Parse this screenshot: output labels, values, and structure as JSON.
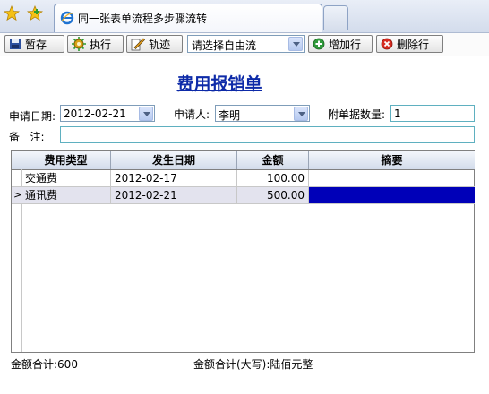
{
  "browser": {
    "tab_title": "同一张表单流程多步骤流转"
  },
  "toolbar": {
    "save_label": "暂存",
    "execute_label": "执行",
    "trace_label": "轨迹",
    "flow_select_value": "请选择自由流",
    "add_row_label": "增加行",
    "delete_row_label": "删除行"
  },
  "form": {
    "title": "费用报销单",
    "apply_date_label": "申请日期:",
    "apply_date_value": "2012-02-21",
    "applicant_label": "申请人:",
    "applicant_value": "李明",
    "attachment_count_label": "附单据数量:",
    "attachment_count_value": "1",
    "remark_label": "备   注:",
    "remark_value": ""
  },
  "grid": {
    "columns": [
      "费用类型",
      "发生日期",
      "金额",
      "摘要"
    ],
    "rows": [
      {
        "type": "交通费",
        "date": "2012-02-17",
        "amount": "100.00",
        "summary": ""
      },
      {
        "type": "通讯费",
        "date": "2012-02-21",
        "amount": "500.00",
        "summary": ""
      }
    ],
    "current_row_indicator": ">"
  },
  "footer": {
    "total_label": "金额合计:",
    "total_value": "600",
    "total_upper_label": "金额合计(大写):",
    "total_upper_value": "陆佰元整"
  },
  "colors": {
    "title": "#0d2aa8",
    "selected_cell": "#0000b8"
  }
}
